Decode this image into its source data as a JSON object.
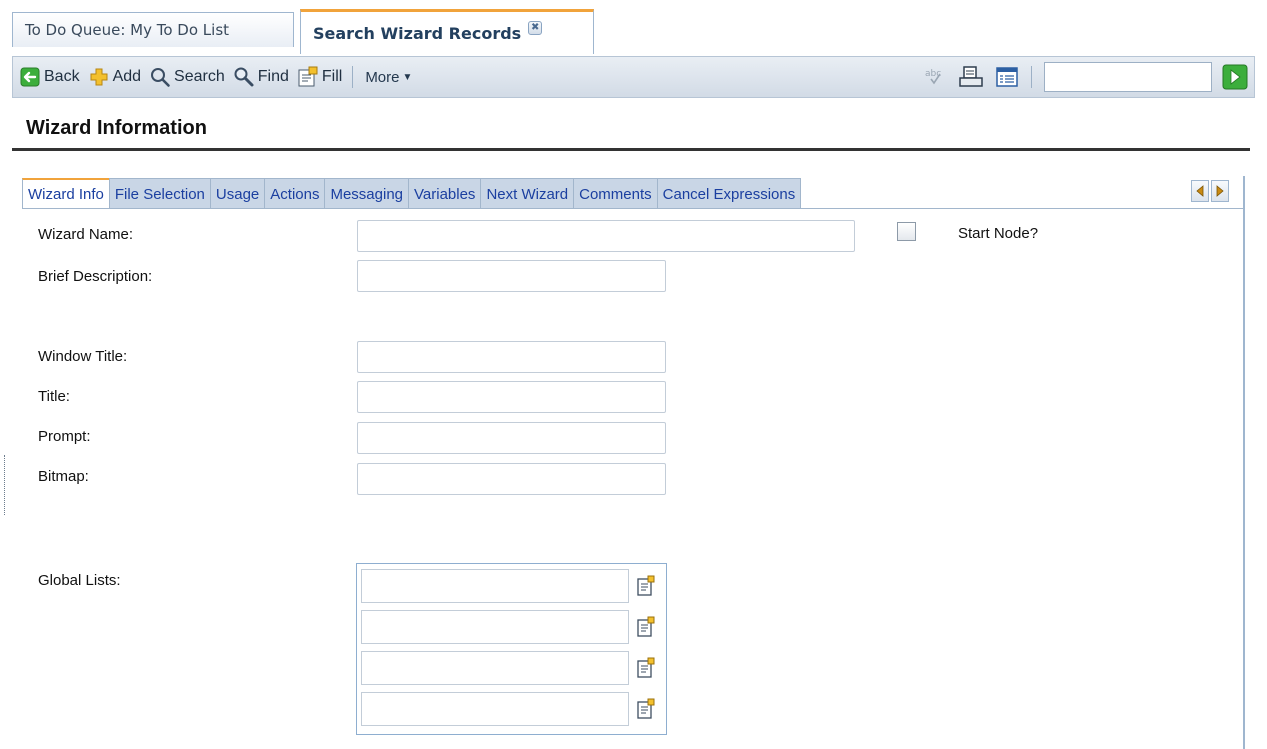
{
  "top_tabs": [
    {
      "label": "To Do Queue: My To Do List",
      "active": false
    },
    {
      "label": "Search Wizard Records",
      "active": true,
      "close": "✖"
    }
  ],
  "toolbar": {
    "back": "Back",
    "add": "Add",
    "search": "Search",
    "find": "Find",
    "fill": "Fill",
    "more": "More",
    "search_value": ""
  },
  "section": {
    "title": "Wizard Information"
  },
  "inner_tabs": [
    "Wizard Info",
    "File Selection",
    "Usage",
    "Actions",
    "Messaging",
    "Variables",
    "Next Wizard",
    "Comments",
    "Cancel Expressions"
  ],
  "form": {
    "wizard_name": {
      "label": "Wizard Name:",
      "value": ""
    },
    "start_node": {
      "label": "Start Node?",
      "checked": false
    },
    "brief_description": {
      "label": "Brief Description:",
      "value": ""
    },
    "window_title": {
      "label": "Window Title:",
      "value": ""
    },
    "title": {
      "label": "Title:",
      "value": ""
    },
    "prompt": {
      "label": "Prompt:",
      "value": ""
    },
    "bitmap": {
      "label": "Bitmap:",
      "value": ""
    },
    "global_lists": {
      "label": "Global Lists:",
      "values": [
        "",
        "",
        "",
        ""
      ]
    }
  },
  "colors": {
    "accent_tab": "#f1a33b",
    "tab_text": "#1b3fa0",
    "go_green": "#3cae3c"
  }
}
